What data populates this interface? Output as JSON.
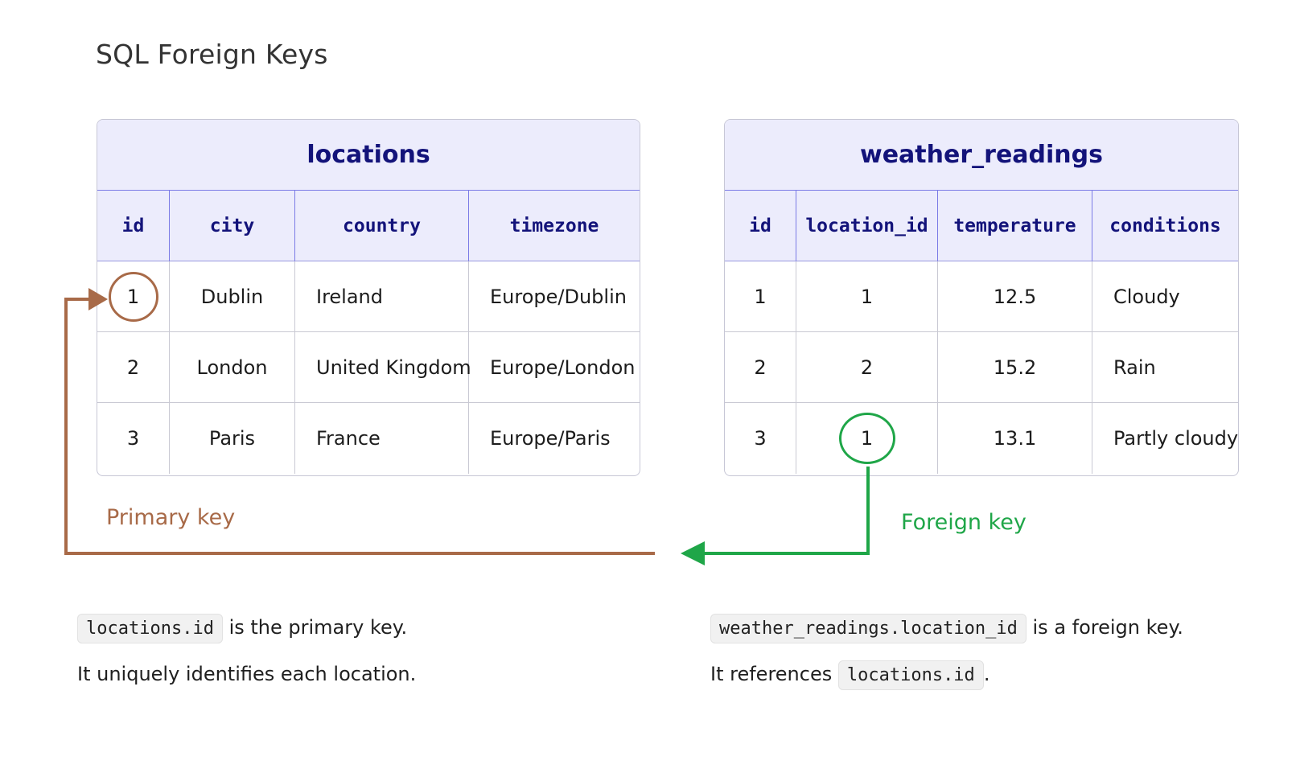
{
  "page": {
    "title": "SQL Foreign Keys"
  },
  "locations": {
    "title": "locations",
    "columns": [
      "id",
      "city",
      "country",
      "timezone"
    ],
    "rows": [
      [
        "1",
        "Dublin",
        "Ireland",
        "Europe/Dublin"
      ],
      [
        "2",
        "London",
        "United Kingdom",
        "Europe/London"
      ],
      [
        "3",
        "Paris",
        "France",
        "Europe/Paris"
      ]
    ]
  },
  "weather_readings": {
    "title": "weather_readings",
    "columns": [
      "id",
      "location_id",
      "temperature",
      "conditions"
    ],
    "rows": [
      [
        "1",
        "1",
        "12.5",
        "Cloudy"
      ],
      [
        "2",
        "2",
        "15.2",
        "Rain"
      ],
      [
        "3",
        "1",
        "13.1",
        "Partly cloudy"
      ]
    ]
  },
  "labels": {
    "primary_key": "Primary key",
    "foreign_key": "Foreign key"
  },
  "notes": {
    "left": {
      "code1": "locations.id",
      "text1": "is the primary key.",
      "line2": "It uniquely identifies each location."
    },
    "right": {
      "code1": "weather_readings.location_id",
      "text1": "is a foreign key.",
      "line2_prefix": "It references",
      "code2": "locations.id",
      "line2_suffix": "."
    }
  },
  "colors": {
    "primary_key": "#a86a48",
    "foreign_key": "#1fa648",
    "header_bg": "#ececfc",
    "header_text": "#13137a"
  }
}
